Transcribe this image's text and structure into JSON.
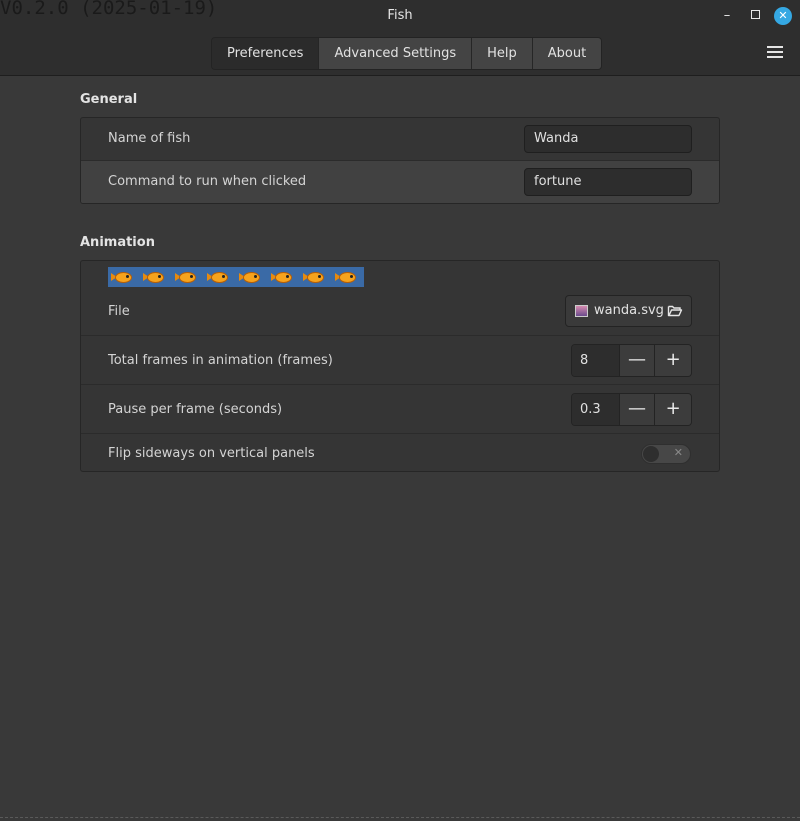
{
  "version_text": "V0.2.0 (2025-01-19)",
  "window": {
    "title": "Fish",
    "minimize_glyph": "–",
    "close_glyph": "✕"
  },
  "tabs": [
    {
      "label": "Preferences",
      "active": true
    },
    {
      "label": "Advanced Settings",
      "active": false
    },
    {
      "label": "Help",
      "active": false
    },
    {
      "label": "About",
      "active": false
    }
  ],
  "general": {
    "title": "General",
    "name_label": "Name of fish",
    "name_value": "Wanda",
    "command_label": "Command to run when clicked",
    "command_value": "fortune"
  },
  "animation": {
    "title": "Animation",
    "file_label": "File",
    "file_name": "wanda.svg",
    "frames_label": "Total frames in animation (frames)",
    "frames_value": "8",
    "pause_label": "Pause per frame (seconds)",
    "pause_value": "0.3",
    "flip_label": "Flip sideways on vertical panels",
    "flip_enabled": false,
    "minus_glyph": "—",
    "plus_glyph": "+",
    "toggle_off_glyph": "✕"
  },
  "colors": {
    "accent": "#35a8e3",
    "fish": "#f6a31d",
    "strip": "#3a6aa6"
  }
}
